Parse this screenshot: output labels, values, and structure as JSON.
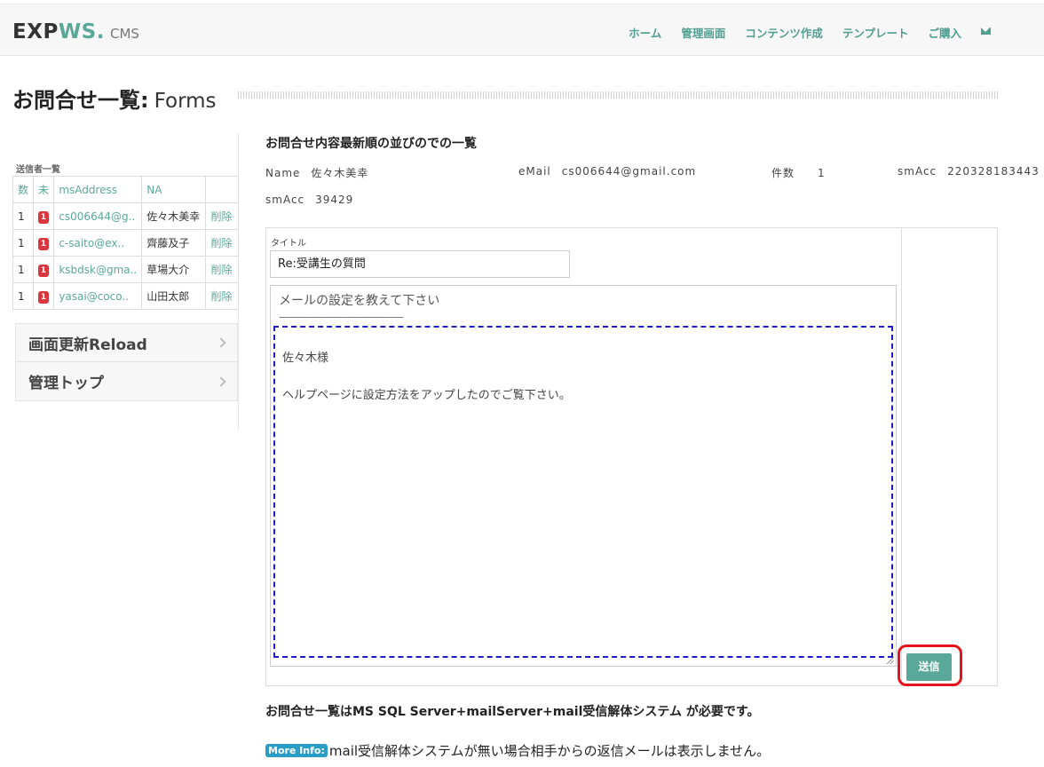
{
  "brand": {
    "part1": "EXP",
    "part2": "WS.",
    "suffix": "CMS"
  },
  "nav": [
    {
      "label": "ホーム"
    },
    {
      "label": "管理画面"
    },
    {
      "label": "コンテンツ作成"
    },
    {
      "label": "テンプレート"
    },
    {
      "label": "ご購入"
    }
  ],
  "nav_icon": "envelope-icon",
  "page": {
    "title": "お問合せ一覧:",
    "subtitle": "Forms"
  },
  "senders": {
    "caption": "送信者一覧",
    "headers": [
      "数",
      "未",
      "msAddress",
      "NA",
      ""
    ],
    "rows": [
      {
        "count": "1",
        "unread": "1",
        "address": "cs006644@g..",
        "name": "佐々木美幸",
        "action": "削除"
      },
      {
        "count": "1",
        "unread": "1",
        "address": "c-saito@ex..",
        "name": "齊藤及子",
        "action": "削除"
      },
      {
        "count": "1",
        "unread": "1",
        "address": "ksbdsk@gma..",
        "name": "草場大介",
        "action": "削除"
      },
      {
        "count": "1",
        "unread": "1",
        "address": "yasai@coco..",
        "name": "山田太郎",
        "action": "削除"
      }
    ]
  },
  "menu": [
    {
      "label": "画面更新Reload"
    },
    {
      "label": "管理トップ"
    }
  ],
  "detail": {
    "heading": "お問合せ内容最新順の並びのでの一覧",
    "name_label": "Name",
    "name_value": "佐々木美幸",
    "email_label": "eMail",
    "email_value": "cs006644@gmail.com",
    "count_label": "件数",
    "count_value": "1",
    "smacc1_label": "smAcc",
    "smacc1_value": "220328183443",
    "smacc2_label": "smAcc",
    "smacc2_value": "39429"
  },
  "form": {
    "title_label": "タイトル",
    "title_value": "Re:受講生の質問",
    "quote": "メールの設定を教えて下さい",
    "separator": "------------------------------------------",
    "body_line1": "佐々木様",
    "body_line2": "ヘルプページに設定方法をアップしたのでご覧下さい。",
    "send_label": "送信"
  },
  "footer": {
    "requirement": "お問合せ一覧はMS SQL Server+mailServer+mail受信解体システム が必要です。",
    "info_badge": "More Info:",
    "info_text": "mail受信解体システムが無い場合相手からの返信メールは表示しません。"
  }
}
